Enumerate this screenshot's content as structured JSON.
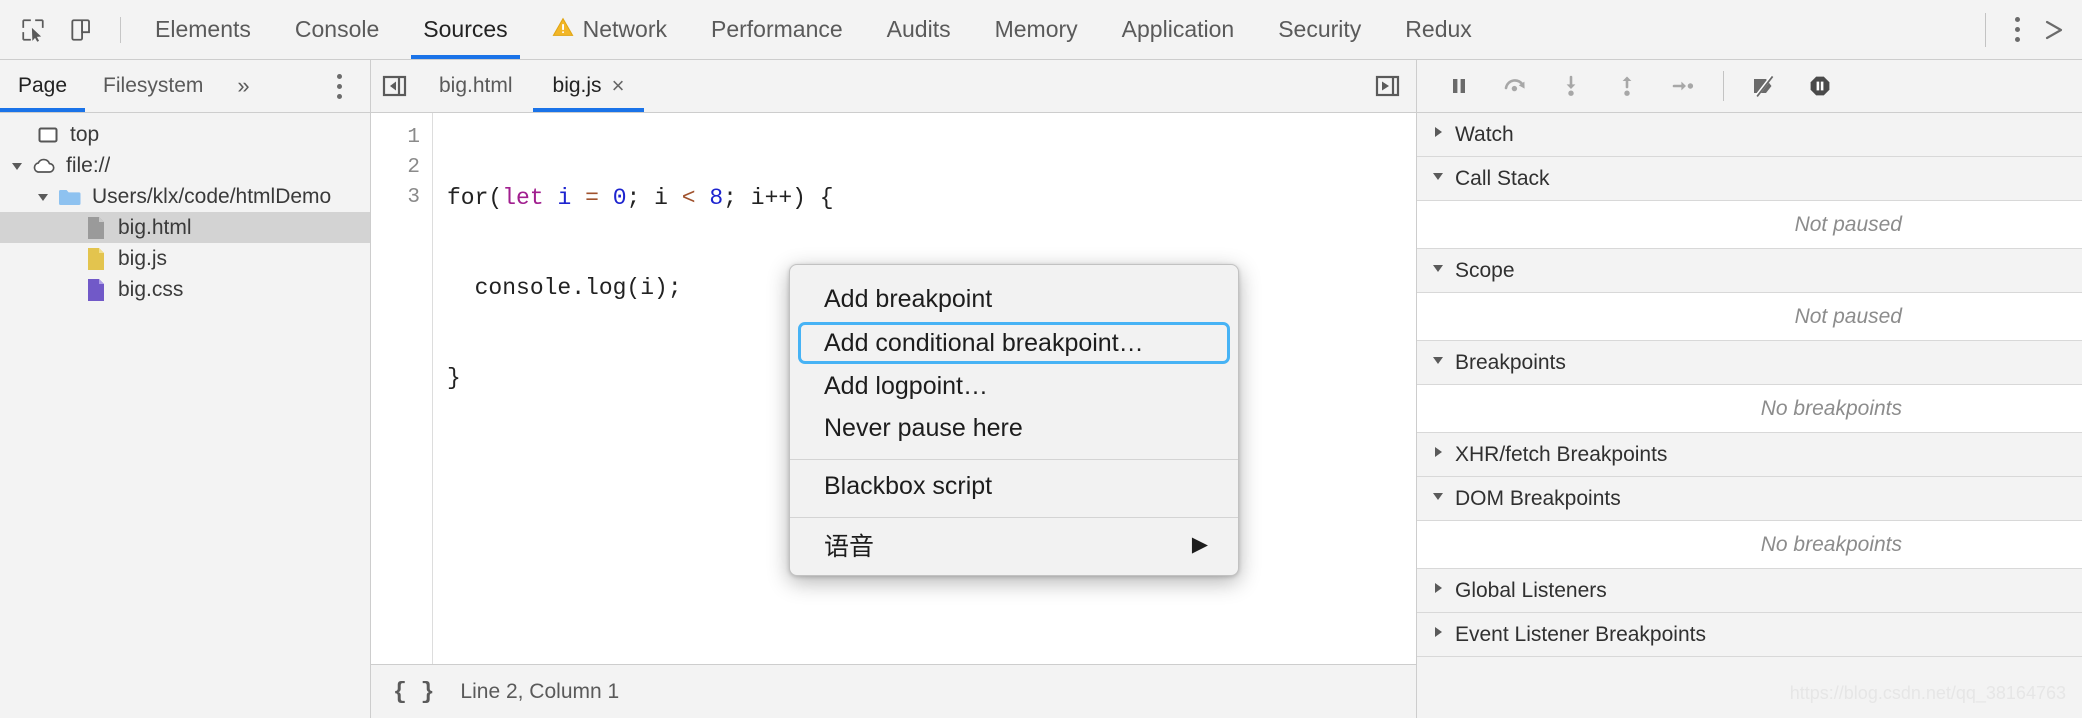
{
  "theme": {
    "accent": "#1a73e8",
    "focus_ring": "#47b3f5",
    "warn": "#f0b429",
    "selected_row": "#d3d3d3"
  },
  "topbar": {
    "icons": [
      {
        "name": "inspect-element-icon",
        "label": "Inspect element"
      },
      {
        "name": "device-toolbar-icon",
        "label": "Toggle device toolbar"
      }
    ],
    "tabs": [
      {
        "label": "Elements",
        "active": false,
        "warn": false
      },
      {
        "label": "Console",
        "active": false,
        "warn": false
      },
      {
        "label": "Sources",
        "active": true,
        "warn": false
      },
      {
        "label": "Network",
        "active": false,
        "warn": true
      },
      {
        "label": "Performance",
        "active": false,
        "warn": false
      },
      {
        "label": "Audits",
        "active": false,
        "warn": false
      },
      {
        "label": "Memory",
        "active": false,
        "warn": false
      },
      {
        "label": "Application",
        "active": false,
        "warn": false
      },
      {
        "label": "Security",
        "active": false,
        "warn": false
      },
      {
        "label": "Redux",
        "active": false,
        "warn": false
      }
    ],
    "more_label": "Customize and control DevTools",
    "close_label": "Close DevTools"
  },
  "navpanel": {
    "tabs": [
      {
        "label": "Page",
        "active": true
      },
      {
        "label": "Filesystem",
        "active": false
      }
    ],
    "more_tabs_glyph": "»",
    "tree": [
      {
        "label": "top",
        "icon": "frame-icon",
        "depth": 0,
        "twisty": "none",
        "selected": false
      },
      {
        "label": "file://",
        "icon": "cloud-icon",
        "depth": 0,
        "twisty": "open",
        "selected": false
      },
      {
        "label": "Users/klx/code/htmlDemo",
        "icon": "folder-icon",
        "depth": 1,
        "twisty": "open",
        "selected": false
      },
      {
        "label": "big.html",
        "icon": "file-html-icon",
        "depth": 2,
        "twisty": "none",
        "selected": true
      },
      {
        "label": "big.js",
        "icon": "file-js-icon",
        "depth": 2,
        "twisty": "none",
        "selected": false
      },
      {
        "label": "big.css",
        "icon": "file-css-icon",
        "depth": 2,
        "twisty": "none",
        "selected": false
      }
    ]
  },
  "editor": {
    "tabs": [
      {
        "label": "big.html",
        "active": false,
        "closable": false
      },
      {
        "label": "big.js",
        "active": true,
        "closable": true,
        "close_glyph": "×"
      }
    ],
    "line_numbers": [
      "1",
      "2",
      "3"
    ],
    "code_lines": [
      [
        {
          "t": "for(",
          "c": "plain"
        },
        {
          "t": "let",
          "c": "kw"
        },
        {
          "t": " ",
          "c": "plain"
        },
        {
          "t": "i",
          "c": "var"
        },
        {
          "t": " ",
          "c": "plain"
        },
        {
          "t": "=",
          "c": "op"
        },
        {
          "t": " ",
          "c": "plain"
        },
        {
          "t": "0",
          "c": "num"
        },
        {
          "t": "; ",
          "c": "plain"
        },
        {
          "t": "i",
          "c": "plain"
        },
        {
          "t": " ",
          "c": "plain"
        },
        {
          "t": "<",
          "c": "op"
        },
        {
          "t": " ",
          "c": "plain"
        },
        {
          "t": "8",
          "c": "num"
        },
        {
          "t": "; i++) {",
          "c": "plain"
        }
      ],
      [
        {
          "t": "  console.log(i);",
          "c": "plain"
        }
      ],
      [
        {
          "t": "}",
          "c": "plain"
        }
      ]
    ],
    "status": {
      "braces": "{ }",
      "position": "Line 2, Column 1"
    }
  },
  "context_menu": {
    "groups": [
      {
        "items": [
          {
            "label": "Add breakpoint",
            "focused": false,
            "submenu": false
          },
          {
            "label": "Add conditional breakpoint…",
            "focused": true,
            "submenu": false
          },
          {
            "label": "Add logpoint…",
            "focused": false,
            "submenu": false
          },
          {
            "label": "Never pause here",
            "focused": false,
            "submenu": false
          }
        ]
      },
      {
        "items": [
          {
            "label": "Blackbox script",
            "focused": false,
            "submenu": false
          }
        ]
      },
      {
        "items": [
          {
            "label": "语音",
            "focused": false,
            "submenu": true,
            "submenu_glyph": "▶"
          }
        ]
      }
    ]
  },
  "debugger": {
    "toolbar": [
      {
        "name": "pause-script-icon",
        "label": "Pause script execution"
      },
      {
        "name": "step-over-icon",
        "label": "Step over next function call"
      },
      {
        "name": "step-into-icon",
        "label": "Step into next function call"
      },
      {
        "name": "step-out-icon",
        "label": "Step out of current function"
      },
      {
        "name": "step-icon",
        "label": "Step"
      },
      {
        "name": "deactivate-breakpoints-icon",
        "label": "Deactivate breakpoints"
      },
      {
        "name": "pause-on-exceptions-icon",
        "label": "Pause on exceptions"
      }
    ],
    "sections": [
      {
        "title": "Watch",
        "expanded": false,
        "empty_text": null
      },
      {
        "title": "Call Stack",
        "expanded": true,
        "empty_text": "Not paused"
      },
      {
        "title": "Scope",
        "expanded": true,
        "empty_text": "Not paused"
      },
      {
        "title": "Breakpoints",
        "expanded": true,
        "empty_text": "No breakpoints"
      },
      {
        "title": "XHR/fetch Breakpoints",
        "expanded": false,
        "empty_text": null
      },
      {
        "title": "DOM Breakpoints",
        "expanded": true,
        "empty_text": "No breakpoints"
      },
      {
        "title": "Global Listeners",
        "expanded": false,
        "empty_text": null
      },
      {
        "title": "Event Listener Breakpoints",
        "expanded": false,
        "empty_text": null
      }
    ]
  },
  "watermark": "https://blog.csdn.net/qq_38164763"
}
